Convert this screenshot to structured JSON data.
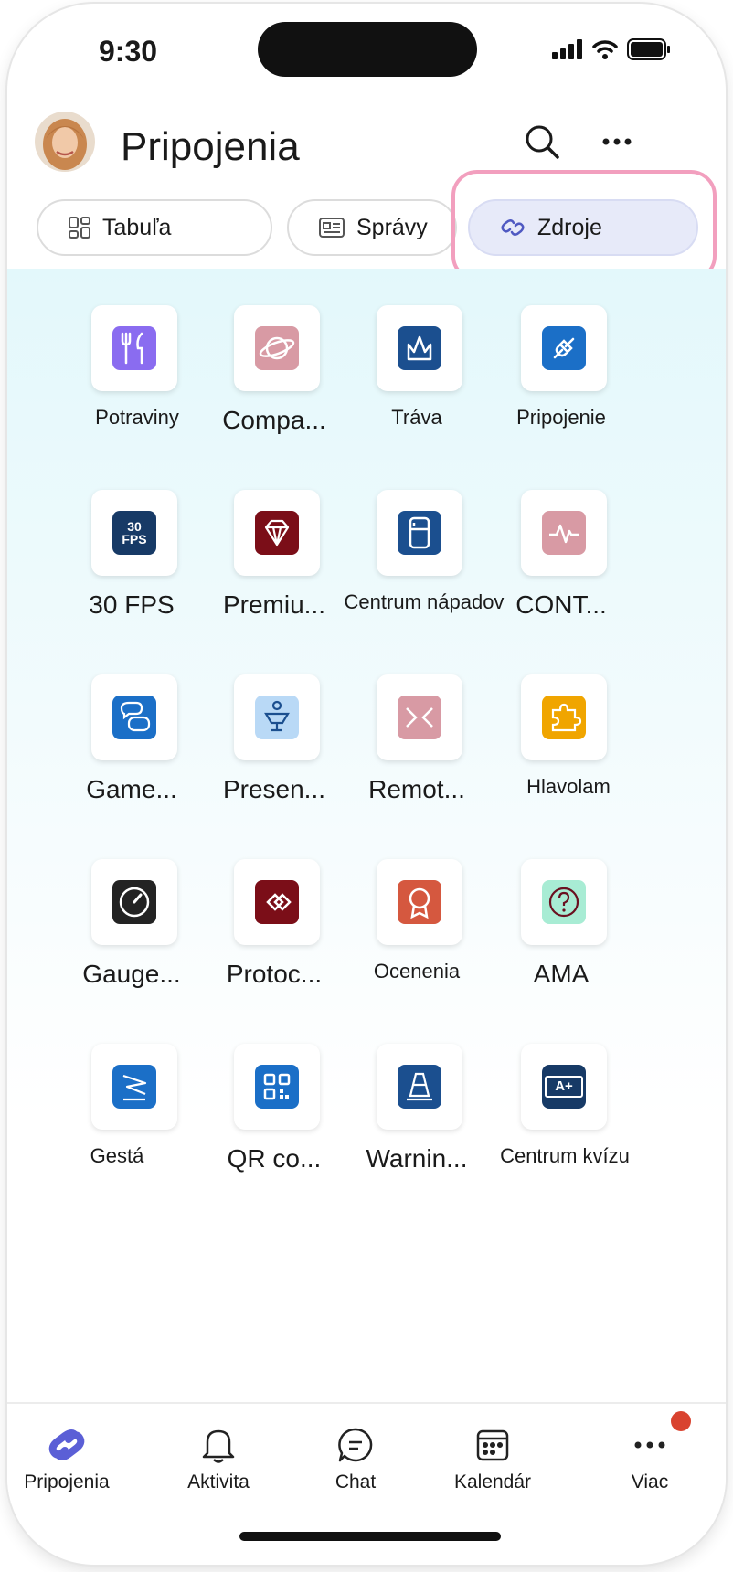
{
  "status": {
    "time": "9:30"
  },
  "header": {
    "title": "Pripojenia"
  },
  "tabs": [
    {
      "label": "Tabuľa",
      "icon": "dashboard-icon"
    },
    {
      "label": "Správy",
      "icon": "news-icon"
    },
    {
      "label": "Zdroje",
      "icon": "link-icon",
      "active": true
    }
  ],
  "apps": [
    {
      "label": "Potraviny",
      "icon": "fork-knife-icon",
      "color": "#8a6cf0"
    },
    {
      "label": "Compa...",
      "icon": "planet-icon",
      "color": "#d89aa4"
    },
    {
      "label": "Tráva",
      "icon": "grass-icon",
      "color": "#1b4f8f"
    },
    {
      "label": "Pripojenie",
      "icon": "plug-icon",
      "color": "#1b6fc7"
    },
    {
      "label": "30 FPS",
      "icon": "fps-icon",
      "icon_text": "30 FPS",
      "color": "#173a66"
    },
    {
      "label": "Premiu...",
      "icon": "diamond-icon",
      "color": "#7b0e18"
    },
    {
      "label": "Centrum nápadov",
      "icon": "fridge-icon",
      "color": "#1b4f8f"
    },
    {
      "label": "CONT...",
      "icon": "pulse-icon",
      "color": "#d89aa4"
    },
    {
      "label": "Game...",
      "icon": "game-chat-icon",
      "color": "#1b6fc7"
    },
    {
      "label": "Presen...",
      "icon": "podium-icon",
      "color": "#b9d9f6"
    },
    {
      "label": "Remot...",
      "icon": "remote-icon",
      "color": "#d89aa4"
    },
    {
      "label": "Hlavolam",
      "icon": "puzzle-icon",
      "color": "#f0a500"
    },
    {
      "label": "Gauge...",
      "icon": "gauge-icon",
      "color": "#232323"
    },
    {
      "label": "Protoc...",
      "icon": "protocol-icon",
      "color": "#7b0e18"
    },
    {
      "label": "Ocenenia",
      "icon": "award-icon",
      "color": "#d5583f"
    },
    {
      "label": "AMA",
      "icon": "question-icon",
      "color": "#a8ecd4"
    },
    {
      "label": "Gestá",
      "icon": "gesture-icon",
      "color": "#1b6fc7"
    },
    {
      "label": "QR co...",
      "icon": "qr-icon",
      "color": "#1b6fc7"
    },
    {
      "label": "Warnin...",
      "icon": "cone-icon",
      "color": "#1b4f8f"
    },
    {
      "label": "Centrum kvízu",
      "icon": "quiz-icon",
      "icon_text": "A+",
      "color": "#173a66"
    }
  ],
  "nav": [
    {
      "label": "Pripojenia",
      "icon": "connections-icon",
      "active": true
    },
    {
      "label": "Aktivita",
      "icon": "bell-icon"
    },
    {
      "label": "Chat",
      "icon": "chat-icon"
    },
    {
      "label": "Kalendár",
      "icon": "calendar-icon"
    },
    {
      "label": "Viac",
      "icon": "more-icon",
      "badge": true
    }
  ]
}
